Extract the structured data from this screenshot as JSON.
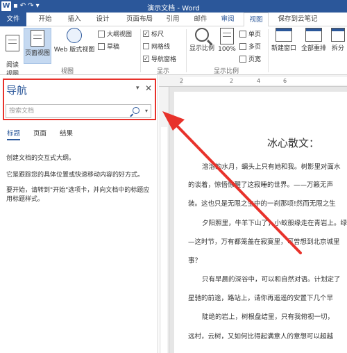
{
  "window": {
    "title": "演示文档 - Word"
  },
  "qat": {
    "logo": "W",
    "save": "▪",
    "undo": "↶",
    "redo": "↷",
    "customize": "▾"
  },
  "tabs": [
    "文件",
    "开始",
    "插入",
    "设计",
    "页面布局",
    "引用",
    "邮件",
    "审阅",
    "视图",
    "保存到云笔记"
  ],
  "ribbon": {
    "read_mode": "阅读\n视图",
    "print_layout": "页面视图",
    "web_layout": "Web 版式视图",
    "outline": "大纲视图",
    "draft": "草稿",
    "views_group": "视图",
    "ruler": "标尺",
    "gridlines": "网格线",
    "nav_pane": "导航窗格",
    "show_group": "显示",
    "zoom": "显示比例",
    "zoom_100": "100%",
    "one_page": "单页",
    "multi_page": "多页",
    "page_width": "页宽",
    "zoom_group": "显示比例",
    "new_window": "新建窗口",
    "arrange_all": "全部重排",
    "split": "拆分",
    "check_ruler": true,
    "check_gridlines": false,
    "check_nav": true
  },
  "nav": {
    "title": "导航",
    "search_placeholder": "搜索文档",
    "tabs": [
      "标题",
      "页面",
      "结果"
    ],
    "text1": "创建文档的交互式大纲。",
    "text2": "它是跟踪您的具体位置或快速移动内容的好方式。",
    "text3": "要开始，请转到\"开始\"选项卡，并向文档中的标题应用标题样式。"
  },
  "ruler": {
    "h": [
      "2",
      "2",
      "4",
      "6"
    ]
  },
  "document": {
    "title": "冰心散文：",
    "lines": [
      "溶溶的水月，螭头上只有她和我。树影里对面水",
      "的谈着，惊悟惊醒了这寂睡的世界。——万籁无声",
      "装。这也只是无限之生中的一刹那顷!然而无限之生",
      "夕阳照里，牛羊下山了，小蚁般缘走在青岩上。绿",
      "—这时节，万有都笼盖在寂寞里，可曾想到北京城里",
      "事？",
      "只有早晨的深谷中，可以和自然对语。计划定了",
      "星驰的前途，路站上，请你再遥遥的安置下几个早",
      "陡绝的岩上，树根盘结里，只有我俯视一切，",
      "远村，云树，又如何比得起满意人的意想可以超越"
    ]
  }
}
